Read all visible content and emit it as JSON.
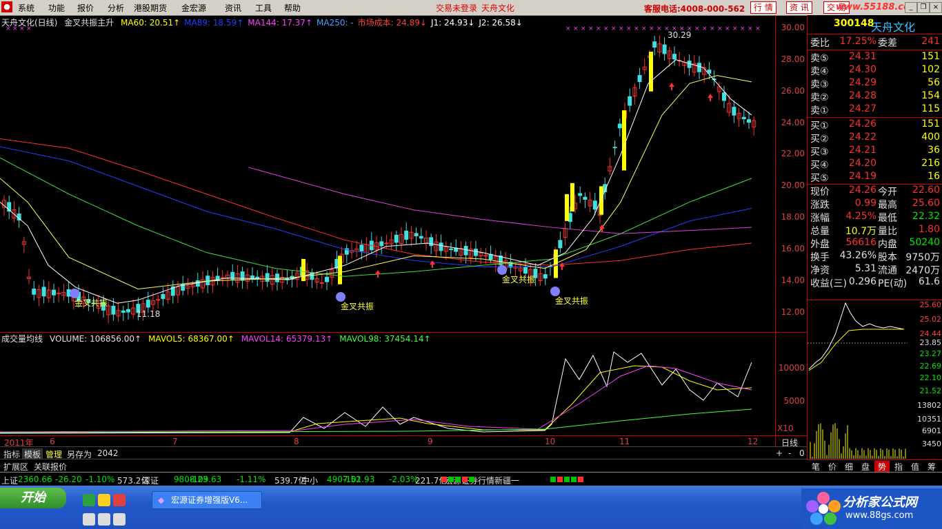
{
  "menu": {
    "items": [
      "系统",
      "功能",
      "报价",
      "分析",
      "港股期货",
      "金宏源",
      "资讯",
      "工具",
      "帮助"
    ],
    "status": "交易未登录",
    "stock_name_top": "天舟文化",
    "hotline": "客服电话:4008-000-562",
    "buttons": [
      "行 情",
      "资 讯",
      "交 易"
    ],
    "site": "www.55188.com"
  },
  "legend": {
    "title": "天舟文化(日线)",
    "formula": "金叉共振主升",
    "items": [
      {
        "label": "MA60: 20.51↑",
        "color": "#ffff00"
      },
      {
        "label": "MA89: 18.59↑",
        "color": "#2040ff"
      },
      {
        "label": "MA144: 17.37↑",
        "color": "#ff40ff"
      },
      {
        "label": "MA250: -",
        "color": "#40a0ff"
      },
      {
        "label": "市场成本: 24.89↓",
        "color": "#ff4040"
      },
      {
        "label": "J1: 24.93↓",
        "color": "#ffffff"
      },
      {
        "label": "J2: 26.58↓",
        "color": "#ffffff"
      }
    ]
  },
  "price_axis": {
    "ticks": [
      "30.00",
      "28.00",
      "26.00",
      "24.00",
      "22.00",
      "20.00",
      "18.00",
      "16.00",
      "14.00",
      "12.00"
    ]
  },
  "annotations": [
    {
      "text": "金叉共振",
      "x": 108,
      "y": 444
    },
    {
      "text": "金叉共振",
      "x": 494,
      "y": 449
    },
    {
      "text": "金叉共振",
      "x": 728,
      "y": 410
    },
    {
      "text": "金叉共振",
      "x": 805,
      "y": 441
    },
    {
      "text": "30.29",
      "x": 968,
      "y": 55
    },
    {
      "text": "11.18",
      "x": 198,
      "y": 460
    }
  ],
  "volume": {
    "legend": [
      {
        "label": "成交量均线",
        "color": "#e0e0e0"
      },
      {
        "label": "VOLUME: 106856.00↑",
        "color": "#e0e0e0"
      },
      {
        "label": "MAVOL5: 68367.00↑",
        "color": "#ffff00"
      },
      {
        "label": "MAVOL14: 65379.13↑",
        "color": "#ff40ff"
      },
      {
        "label": "MAVOL98: 37454.14↑",
        "color": "#40ff40"
      }
    ],
    "ticks": [
      "10000",
      "5000"
    ],
    "unit": "X10"
  },
  "dates": [
    "2011年",
    "6",
    "7",
    "8",
    "9",
    "10",
    "11",
    "12"
  ],
  "tabs": [
    "指标",
    "模板",
    "管理",
    "另存为",
    "2042"
  ],
  "tabs2": [
    "扩展区",
    "关联报价"
  ],
  "zoom": [
    "+",
    "-",
    "0"
  ],
  "zoom_label": "日线",
  "quote": {
    "code": "300148",
    "name": "天舟文化",
    "ratio_label": "委比",
    "ratio": "17.25%",
    "diff_label": "委差",
    "diff": "241",
    "asks": [
      {
        "label": "卖⑤",
        "price": "24.31",
        "vol": "151"
      },
      {
        "label": "卖④",
        "price": "24.30",
        "vol": "102"
      },
      {
        "label": "卖③",
        "price": "24.29",
        "vol": "56"
      },
      {
        "label": "卖②",
        "price": "24.28",
        "vol": "154"
      },
      {
        "label": "卖①",
        "price": "24.27",
        "vol": "115"
      }
    ],
    "bids": [
      {
        "label": "买①",
        "price": "24.26",
        "vol": "151"
      },
      {
        "label": "买②",
        "price": "24.22",
        "vol": "400"
      },
      {
        "label": "买③",
        "price": "24.21",
        "vol": "36"
      },
      {
        "label": "买④",
        "price": "24.20",
        "vol": "216"
      },
      {
        "label": "买⑤",
        "price": "24.19",
        "vol": "16"
      }
    ],
    "stats": [
      {
        "l1": "现价",
        "v1": "24.26",
        "c1": "red",
        "l2": "今开",
        "v2": "22.60",
        "c2": "red"
      },
      {
        "l1": "涨跌",
        "v1": "0.99",
        "c1": "red",
        "l2": "最高",
        "v2": "25.60",
        "c2": "red"
      },
      {
        "l1": "涨幅",
        "v1": "4.25%",
        "c1": "red",
        "l2": "最低",
        "v2": "22.32",
        "c2": "green"
      },
      {
        "l1": "总量",
        "v1": "10.7万",
        "c1": "yellow",
        "l2": "量比",
        "v2": "1.80",
        "c2": "red"
      },
      {
        "l1": "外盘",
        "v1": "56616",
        "c1": "red",
        "l2": "内盘",
        "v2": "50240",
        "c2": "green"
      },
      {
        "l1": "换手",
        "v1": "43.26%",
        "c1": "white",
        "l2": "股本",
        "v2": "9750万",
        "c2": "white"
      },
      {
        "l1": "净资",
        "v1": "5.31",
        "c1": "white",
        "l2": "流通",
        "v2": "2470万",
        "c2": "white"
      },
      {
        "l1": "收益(三)",
        "v1": "0.296",
        "c1": "white",
        "l2": "PE(动)",
        "v2": "61.6",
        "c2": "white"
      }
    ]
  },
  "mini": {
    "ticks": [
      {
        "t": "25.60",
        "c": "#ff4040"
      },
      {
        "t": "25.02",
        "c": "#ff4040"
      },
      {
        "t": "24.44",
        "c": "#ff4040"
      },
      {
        "t": "23.85",
        "c": "#ddd"
      },
      {
        "t": "23.27",
        "c": "#00e600"
      },
      {
        "t": "22.69",
        "c": "#00e600"
      },
      {
        "t": "22.10",
        "c": "#00e600"
      },
      {
        "t": "21.52",
        "c": "#00e600"
      },
      {
        "t": "13802",
        "c": "#ddd"
      },
      {
        "t": "10351",
        "c": "#ddd"
      },
      {
        "t": "6901",
        "c": "#ddd"
      },
      {
        "t": "3450",
        "c": "#ddd"
      }
    ],
    "tabs": [
      "笔",
      "价",
      "细",
      "盘",
      "势",
      "指",
      "值",
      "筹"
    ]
  },
  "indexbar": [
    {
      "t": "上证",
      "c": "#ddd"
    },
    {
      "t": "2360.66",
      "c": "#00e600"
    },
    {
      "t": "-26.20",
      "c": "#00e600"
    },
    {
      "t": "-1.10%",
      "c": "#00e600"
    },
    {
      "t": "573.2亿",
      "c": "#ddd"
    },
    {
      "t": "深证",
      "c": "#ddd"
    },
    {
      "t": "9808.23",
      "c": "#00e600"
    },
    {
      "t": "-109.63",
      "c": "#00e600"
    },
    {
      "t": "-1.11%",
      "c": "#00e600"
    },
    {
      "t": "539.7亿",
      "c": "#ddd"
    },
    {
      "t": "中小",
      "c": "#ddd"
    },
    {
      "t": "4907.52",
      "c": "#00e600"
    },
    {
      "t": "-101.93",
      "c": "#00e600"
    },
    {
      "t": "-2.03%",
      "c": "#00e600"
    },
    {
      "t": "221.7亿",
      "c": "#ddd"
    },
    {
      "t": "宏源证券行情新疆一",
      "c": "#ddd"
    }
  ],
  "taskbar": {
    "start": "开始",
    "task": "宏源证券增强版V6...",
    "brand1": "分析家公式网",
    "brand2": "www.88gs.com"
  },
  "chart_data": {
    "type": "candlestick",
    "title": "天舟文化(日线)",
    "ylim": [
      11.0,
      30.6
    ],
    "x": [
      "2011年",
      "6",
      "7",
      "8",
      "9",
      "10",
      "11",
      "12"
    ],
    "ma_values": {
      "MA60": 20.51,
      "MA89": 18.59,
      "MA144": 17.37,
      "市场成本": 24.89,
      "J1": 24.93,
      "J2": 26.58
    },
    "high": 30.29,
    "low": 11.18,
    "volume_ylim": [
      0,
      13000
    ]
  }
}
